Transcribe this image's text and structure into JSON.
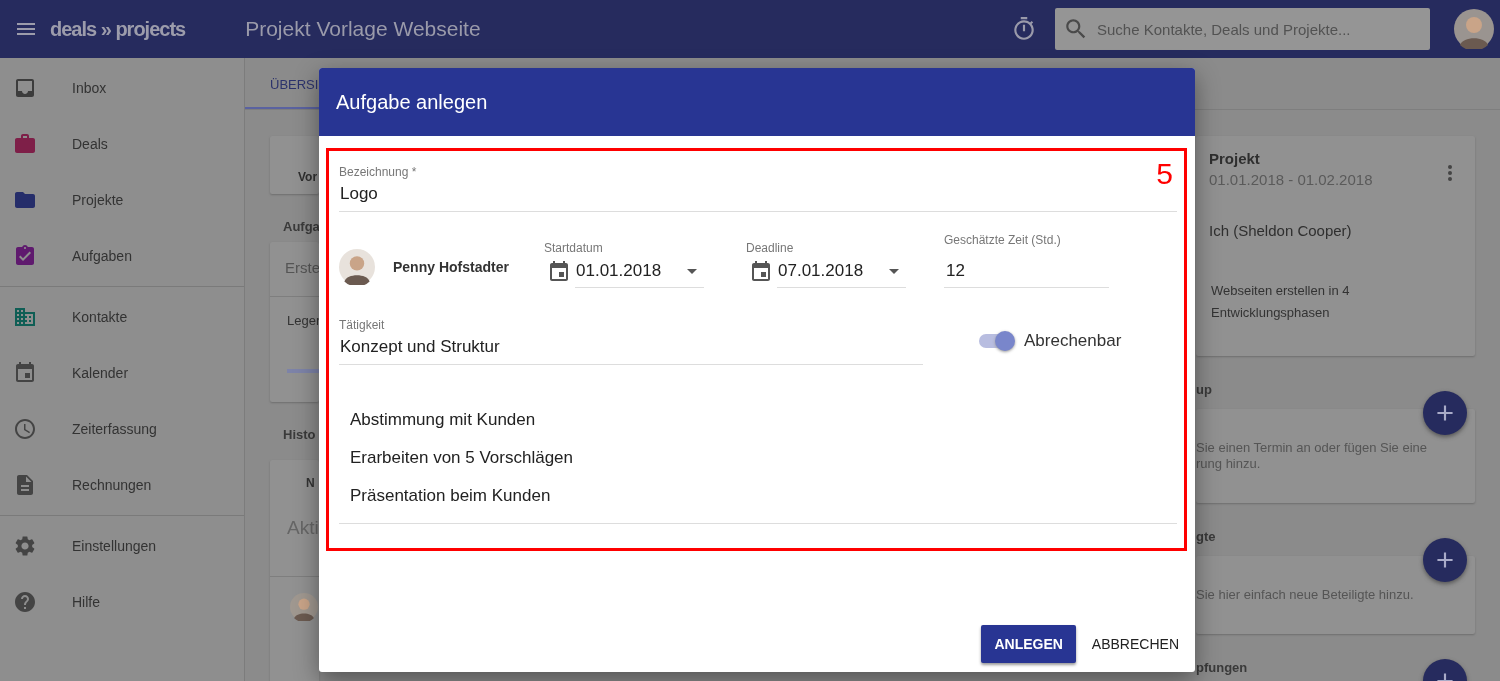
{
  "app_bar": {
    "logo": "deals » projects",
    "title": "Projekt Vorlage Webseite",
    "search": {
      "placeholder": "Suche Kontakte, Deals und Projekte..."
    }
  },
  "sidebar": {
    "sections": [
      {
        "items": [
          {
            "label": "Inbox",
            "kind": "inbox",
            "selected": false
          },
          {
            "label": "Deals",
            "kind": "deals",
            "selected": false
          },
          {
            "label": "Projekte",
            "kind": "projects",
            "selected": false
          },
          {
            "label": "Aufgaben",
            "kind": "tasks",
            "selected": false
          }
        ]
      },
      {
        "items": [
          {
            "label": "Kontakte",
            "kind": "contacts",
            "selected": false
          },
          {
            "label": "Kalender",
            "kind": "calendar",
            "selected": false
          },
          {
            "label": "Zeiterfassung",
            "kind": "time",
            "selected": false
          },
          {
            "label": "Rechnungen",
            "kind": "invoices",
            "selected": false
          }
        ]
      },
      {
        "items": [
          {
            "label": "Einstellungen",
            "kind": "settings",
            "selected": false
          },
          {
            "label": "Hilfe",
            "kind": "help",
            "selected": false
          }
        ]
      }
    ]
  },
  "tabs": [
    {
      "label": "ÜBERSI",
      "selected": true
    }
  ],
  "left_column": {
    "card_1": "Vor",
    "heading_1": "Aufga",
    "card_2": {
      "title": "Erste",
      "text": "Leger"
    },
    "heading_2": "Histo",
    "card_3": {
      "column": "N",
      "title": "Akti"
    }
  },
  "right_column": {
    "project_card": {
      "title": "Projekt",
      "dates": "01.01.2018 - 01.02.2018",
      "owner": "Ich (Sheldon Cooper)",
      "description": "Webseiten erstellen in 4 Entwicklungsphasen"
    },
    "sections": [
      {
        "heading": "up",
        "text": "Sie einen Termin an oder fügen Sie eine\nrung hinzu."
      },
      {
        "heading": "gte",
        "text": "Sie hier einfach neue Beteiligte hinzu."
      },
      {
        "heading": "pfungen"
      }
    ]
  },
  "dialog": {
    "title": "Aufgabe anlegen",
    "annotation": "5",
    "name_field": {
      "label": "Bezeichnung *",
      "value": "Logo"
    },
    "assignee": "Penny Hofstadter",
    "start_date": {
      "label": "Startdatum",
      "value": "01.01.2018"
    },
    "deadline": {
      "label": "Deadline",
      "value": "07.01.2018"
    },
    "estimate": {
      "label": "Geschätzte Zeit (Std.)",
      "value": "12"
    },
    "activity": {
      "label": "Tätigkeit",
      "value": "Konzept und Struktur"
    },
    "billable": {
      "label": "Abrechenbar",
      "on": true
    },
    "items": [
      "Abstimmung mit Kunden",
      "Erarbeiten von 5 Vorschlägen",
      "Präsentation beim Kunden"
    ],
    "buttons": [
      {
        "label": "ANLEGEN",
        "kind": "primary"
      },
      {
        "label": "ABBRECHEN",
        "kind": "text"
      }
    ]
  }
}
